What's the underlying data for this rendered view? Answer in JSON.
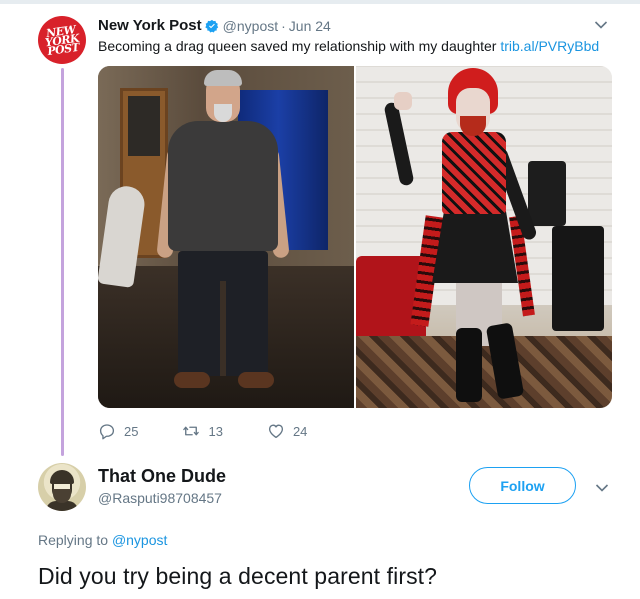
{
  "tweet": {
    "author_name": "New York Post",
    "author_handle": "@nypost",
    "separator": "·",
    "date": "Jun 24",
    "text": "Becoming a drag queen saved my relationship with my daughter",
    "link": "trib.al/PVRyBbd",
    "avatar_logo": [
      "NEW",
      "YORK",
      "POST"
    ],
    "verified": true,
    "media_icons": [
      "photo-father",
      "photo-daughter"
    ],
    "actions": {
      "reply_count": "25",
      "retweet_count": "13",
      "like_count": "24"
    }
  },
  "reply": {
    "author_name": "That One Dude",
    "author_handle": "@Rasputi98708457",
    "follow_label": "Follow",
    "replying_prefix": "Replying to",
    "replying_to": "@nypost",
    "text": "Did you try being a decent parent first?"
  },
  "colors": {
    "accent": "#1da1f2",
    "link": "#1b95e0",
    "muted": "#657786",
    "thread_line": "#c4a3dd",
    "post_brand": "#d8212a"
  }
}
